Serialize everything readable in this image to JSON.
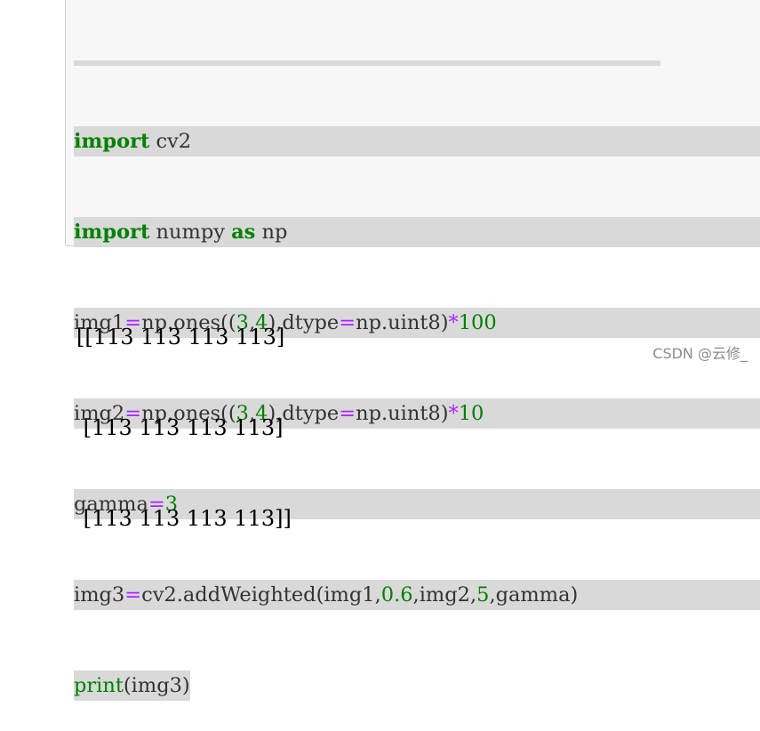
{
  "code_lines": [
    [
      {
        "t": "import",
        "c": "kw"
      },
      {
        "t": " cv2",
        "c": ""
      }
    ],
    [
      {
        "t": "import",
        "c": "kw"
      },
      {
        "t": " numpy ",
        "c": ""
      },
      {
        "t": "as",
        "c": "kw"
      },
      {
        "t": " np",
        "c": ""
      }
    ],
    [
      {
        "t": "img1",
        "c": ""
      },
      {
        "t": "=",
        "c": "eq"
      },
      {
        "t": "np.ones((",
        "c": ""
      },
      {
        "t": "3",
        "c": "num"
      },
      {
        "t": ",",
        "c": ""
      },
      {
        "t": "4",
        "c": "num"
      },
      {
        "t": "),dtype",
        "c": ""
      },
      {
        "t": "=",
        "c": "eq"
      },
      {
        "t": "np.uint8)",
        "c": ""
      },
      {
        "t": "*",
        "c": "op"
      },
      {
        "t": "100",
        "c": "num"
      }
    ],
    [
      {
        "t": "img2",
        "c": ""
      },
      {
        "t": "=",
        "c": "eq"
      },
      {
        "t": "np.ones((",
        "c": ""
      },
      {
        "t": "3",
        "c": "num"
      },
      {
        "t": ",",
        "c": ""
      },
      {
        "t": "4",
        "c": "num"
      },
      {
        "t": "),dtype",
        "c": ""
      },
      {
        "t": "=",
        "c": "eq"
      },
      {
        "t": "np.uint8)",
        "c": ""
      },
      {
        "t": "*",
        "c": "op"
      },
      {
        "t": "10",
        "c": "num"
      }
    ],
    [
      {
        "t": "gamma",
        "c": ""
      },
      {
        "t": "=",
        "c": "eq"
      },
      {
        "t": "3",
        "c": "num"
      }
    ],
    [
      {
        "t": "img3",
        "c": ""
      },
      {
        "t": "=",
        "c": "eq"
      },
      {
        "t": "cv2.addWeighted(img1,",
        "c": ""
      },
      {
        "t": "0.6",
        "c": "num"
      },
      {
        "t": ",img2,",
        "c": ""
      },
      {
        "t": "5",
        "c": "num"
      },
      {
        "t": ",gamma)",
        "c": ""
      }
    ],
    [
      {
        "t": "print",
        "c": "bi"
      },
      {
        "t": "(img3)",
        "c": ""
      }
    ]
  ],
  "output_lines": [
    "[[113 113 113 113]",
    " [113 113 113 113]",
    " [113 113 113 113]]"
  ],
  "watermark": "CSDN @云修_"
}
